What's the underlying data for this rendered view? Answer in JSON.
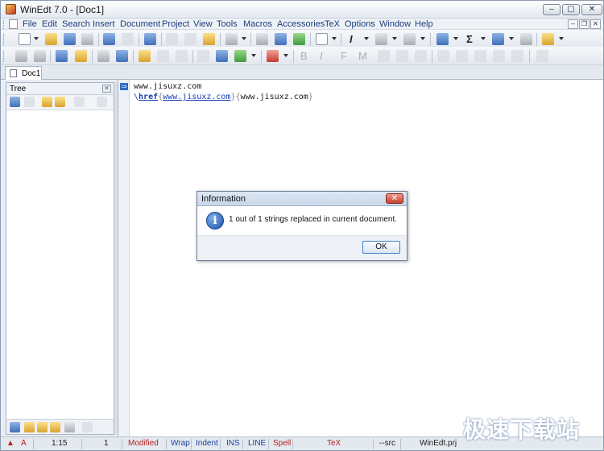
{
  "window": {
    "title": "WinEdt 7.0 - [Doc1]"
  },
  "window_controls": {
    "minimize": "–",
    "maximize": "▢",
    "close": "✕"
  },
  "menu": [
    "File",
    "Edit",
    "Search",
    "Insert",
    "Document",
    "Project",
    "View",
    "Tools",
    "Macros",
    "Accessories",
    "TeX",
    "Options",
    "Window",
    "Help"
  ],
  "mdi_controls": {
    "minimize": "–",
    "restore": "❐",
    "close": "✕"
  },
  "toolbar_text": {
    "italic": "I",
    "sigma": "Σ",
    "bold": "B",
    "italic2": "I",
    "font": "F",
    "math": "M"
  },
  "tab": {
    "label": "Doc1"
  },
  "tree": {
    "title": "Tree",
    "close": "✕"
  },
  "editor": {
    "line1": "www.jisuxz.com",
    "line2": {
      "backslash": "\\",
      "command": "href",
      "open1": "{",
      "url": "www.jisuxz.com",
      "close1": "}",
      "open2": "{",
      "text": "www.jisuxz.com",
      "close2": "}"
    },
    "marker": "⇒"
  },
  "dialog": {
    "title": "Information",
    "close": "✕",
    "icon": "i",
    "message": "1 out of 1 strings replaced in current document.",
    "ok": "OK"
  },
  "status": {
    "mode": "A",
    "position": "1:15",
    "lines": "1",
    "modified": "Modified",
    "wrap": "Wrap",
    "indent": "Indent",
    "ins": "INS",
    "line": "LINE",
    "spell": "Spell",
    "tex": "TeX",
    "src": "--src",
    "project": "WinEdt.prj"
  },
  "watermark": "极速下载站"
}
